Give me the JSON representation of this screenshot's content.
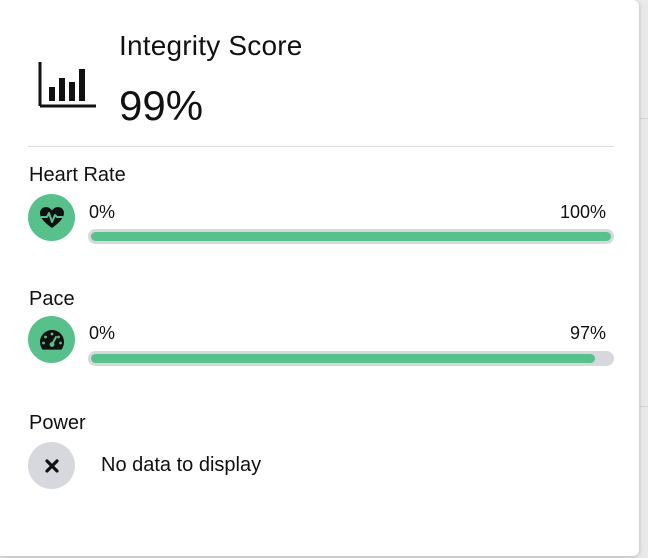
{
  "integrity": {
    "title": "Integrity Score",
    "value": "99%",
    "icon": "bar-chart-icon"
  },
  "metrics": [
    {
      "label": "Heart Rate",
      "icon": "heart-pulse-icon",
      "min": "0%",
      "max": "100%",
      "percent": 100,
      "color": "#57c08b"
    },
    {
      "label": "Pace",
      "icon": "speedometer-icon",
      "min": "0%",
      "max": "97%",
      "percent": 97,
      "color": "#57c08b"
    },
    {
      "label": "Power",
      "icon": "close-icon",
      "status": "No data to display"
    }
  ],
  "colors": {
    "accent": "#57c08b",
    "track": "#d6d8de"
  }
}
